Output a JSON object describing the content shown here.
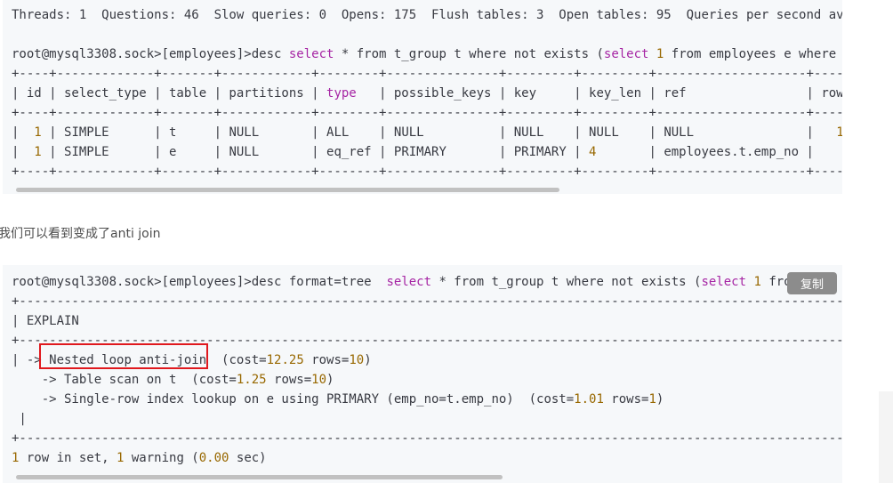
{
  "block1": {
    "status_line": "Threads: 1  Questions: 46  Slow queries: 0  Opens: 175  Flush tables: 3  Open tables: 95  Queries per second av",
    "prompt": "root@mysql3308.sock>[employees]>",
    "cmd_desc": "desc",
    "cmd_select": "select",
    "cmd_mid": " * from t_group t where not exists (",
    "cmd_select2": "select",
    "cmd_num": "1",
    "cmd_tail": " from employees e where",
    "border": "+----+-------------+-------+------------+--------+---------------+---------+---------+--------------------+----",
    "header_a": "| id | select_type | table | partitions | ",
    "header_type": "type",
    "header_b": "   | possible_keys | key     | key_len | ref                | row",
    "row1_a": "|  ",
    "row1_id": "1",
    "row1_b": " | SIMPLE      | t     | NULL       | ALL    | NULL          | NULL    | NULL    | NULL               |   ",
    "row1_rows": "1",
    "row2_a": "|  ",
    "row2_id": "1",
    "row2_b": " | SIMPLE      | e     | NULL       | eq_ref | PRIMARY       | PRIMARY | ",
    "row2_keylen": "4",
    "row2_c": "       | employees.t.emp_no |"
  },
  "prose": "我们可以看到变成了anti join",
  "block2": {
    "prompt": "root@mysql3308.sock>[employees]>",
    "cmd_a": "desc format=tree  ",
    "cmd_select": "select",
    "cmd_b": " * from t_group t where not exists (",
    "cmd_select2": "select",
    "cmd_num": "1",
    "cmd_tail": " fro",
    "dash_line": "+------------------------------------------------------------------------------------------------------------------",
    "explain_header": "| EXPLAIN",
    "tree1_prefix": "| -> ",
    "tree1_label": "Nested loop anti-join",
    "tree1_cost_a": "  (cost=",
    "tree1_cost": "12.25",
    "tree1_rows_a": " rows=",
    "tree1_rows": "10",
    "tree1_end": ")",
    "tree2_a": "    -> Table scan on t  (cost=",
    "tree2_cost": "1.25",
    "tree2_rows_a": " rows=",
    "tree2_rows": "10",
    "tree2_end": ")",
    "tree3_a": "    -> Single-row index lookup on e using PRIMARY (emp_no=t.emp_no)  (cost=",
    "tree3_cost": "1.01",
    "tree3_rows_a": " rows=",
    "tree3_rows": "1",
    "tree3_end": ")",
    "pipe_line": " |",
    "result_a": "",
    "result_n1": "1",
    "result_b": " row in set, ",
    "result_n2": "1",
    "result_c": " warning (",
    "result_n3": "0.00",
    "result_d": " sec)"
  },
  "copy_button": "复制",
  "colors": {
    "keyword": "#a626a4",
    "number": "#986801",
    "highlight": "#e0191e",
    "code_bg": "#f6f8fa"
  }
}
